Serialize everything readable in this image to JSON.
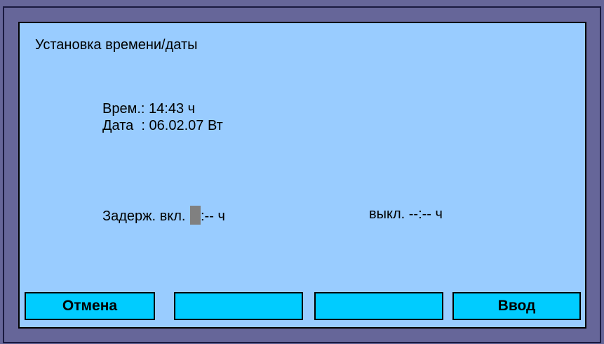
{
  "screen": {
    "title": "Установка времени/даты"
  },
  "clock": {
    "time_label": "Врем.:",
    "time_value": "14:43",
    "time_unit": "ч",
    "date_label": "Дата  :",
    "date_value": "06.02.07",
    "weekday": "Вт"
  },
  "delay": {
    "on_label": "Задерж. вкл.",
    "on_value": ":--",
    "on_unit": "ч",
    "off_label": "выкл.",
    "off_value": "--:--",
    "off_unit": "ч"
  },
  "softkeys": {
    "key1": "Отмена",
    "key2": "",
    "key3": "",
    "key4": "Ввод"
  },
  "colors": {
    "bezel": "#666699",
    "screen": "#99ccff",
    "softkey": "#00ccff",
    "cursor": "#808080"
  }
}
